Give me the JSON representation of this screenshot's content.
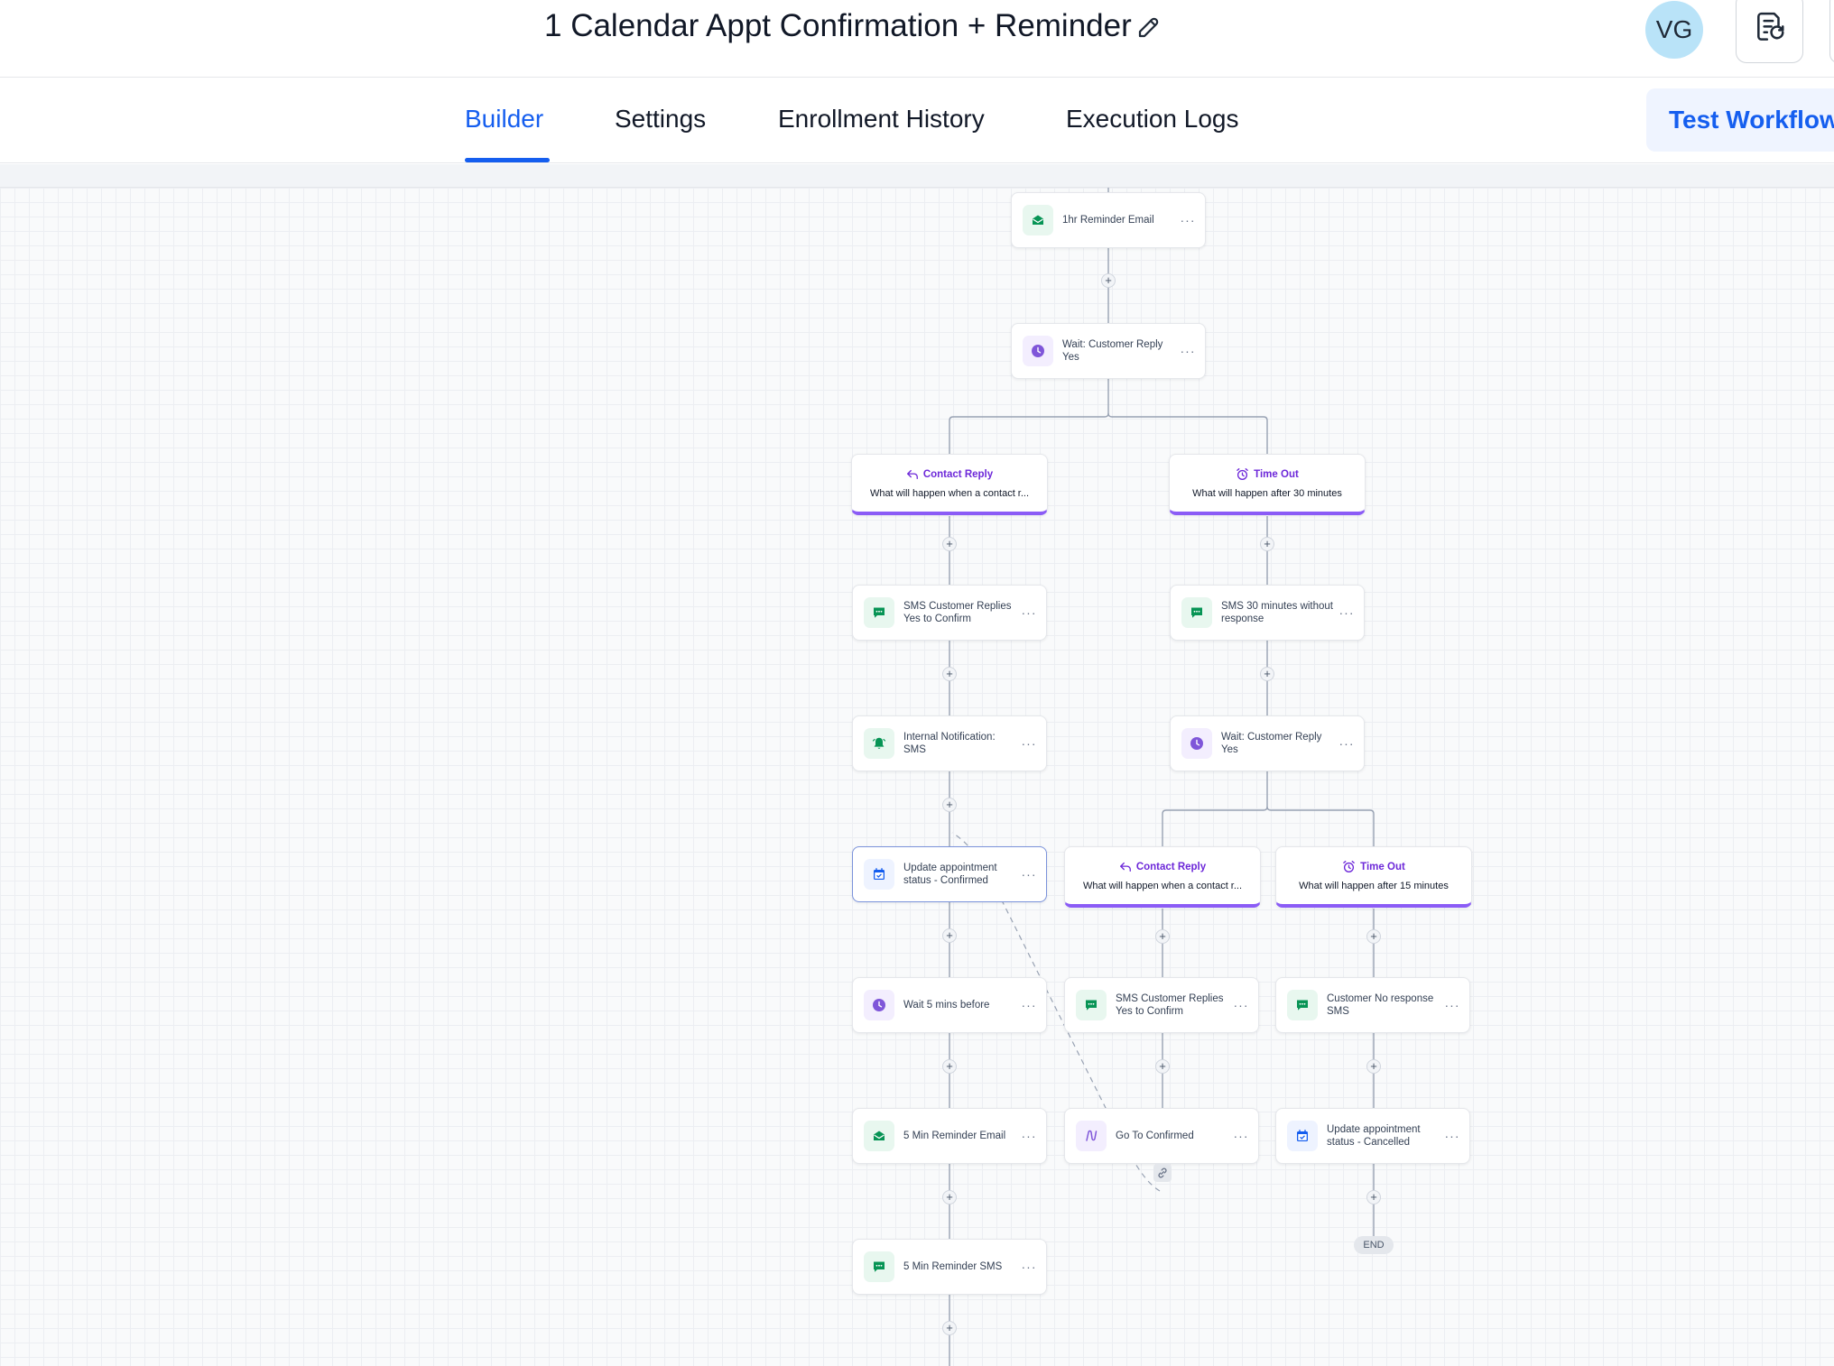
{
  "header": {
    "workflow_title": "1 Calendar Appt Confirmation + Reminder",
    "avatar_initials": "VG"
  },
  "tabs": [
    {
      "label": "Builder",
      "active": true
    },
    {
      "label": "Settings",
      "active": false
    },
    {
      "label": "Enrollment History",
      "active": false
    },
    {
      "label": "Execution Logs",
      "active": false
    }
  ],
  "test_button_label": "Test Workflow",
  "colors": {
    "accent": "#155eef",
    "branch_purple": "#8b5cf6",
    "email_sms_green": "#079455",
    "wait_purple": "#7f56d9",
    "calendar_blue": "#155eef"
  },
  "nodes": {
    "reminder_email_1hr": {
      "label": "1hr Reminder Email",
      "icon": "email-icon"
    },
    "wait_reply_1": {
      "label": "Wait: Customer Reply Yes",
      "icon": "clock-icon"
    },
    "sms_confirm_1": {
      "label": "SMS Customer Replies Yes to Confirm",
      "icon": "sms-icon"
    },
    "internal_notification": {
      "label": "Internal Notification: SMS",
      "icon": "bell-icon"
    },
    "update_confirmed": {
      "label": "Update appointment status - Confirmed",
      "icon": "calendar-check-icon"
    },
    "wait_5_mins": {
      "label": "Wait 5 mins before",
      "icon": "clock-icon"
    },
    "reminder_email_5min": {
      "label": "5 Min Reminder Email",
      "icon": "email-icon"
    },
    "reminder_sms_5min": {
      "label": "5 Min Reminder SMS",
      "icon": "sms-icon"
    },
    "sms_no_response_30": {
      "label": "SMS 30 minutes without response",
      "icon": "sms-icon"
    },
    "wait_reply_2": {
      "label": "Wait: Customer Reply Yes",
      "icon": "clock-icon"
    },
    "sms_confirm_2": {
      "label": "SMS Customer Replies Yes to Confirm",
      "icon": "sms-icon"
    },
    "go_to_confirmed": {
      "label": "Go To Confirmed",
      "icon": "goto-icon"
    },
    "customer_no_response_sms": {
      "label": "Customer No response SMS",
      "icon": "sms-icon"
    },
    "update_cancelled": {
      "label": "Update appointment status - Cancelled",
      "icon": "calendar-check-icon"
    }
  },
  "branches": {
    "contact_reply_1": {
      "title": "Contact Reply",
      "description": "What will happen when a contact r...",
      "icon": "reply-icon"
    },
    "timeout_30": {
      "title": "Time Out",
      "description": "What will happen after 30 minutes",
      "icon": "alarm-icon"
    },
    "contact_reply_2": {
      "title": "Contact Reply",
      "description": "What will happen when a contact r...",
      "icon": "reply-icon"
    },
    "timeout_15": {
      "title": "Time Out",
      "description": "What will happen after 15 minutes",
      "icon": "alarm-icon"
    }
  },
  "end_label": "END",
  "node_menu_glyph": "···",
  "plus_glyph": "+"
}
